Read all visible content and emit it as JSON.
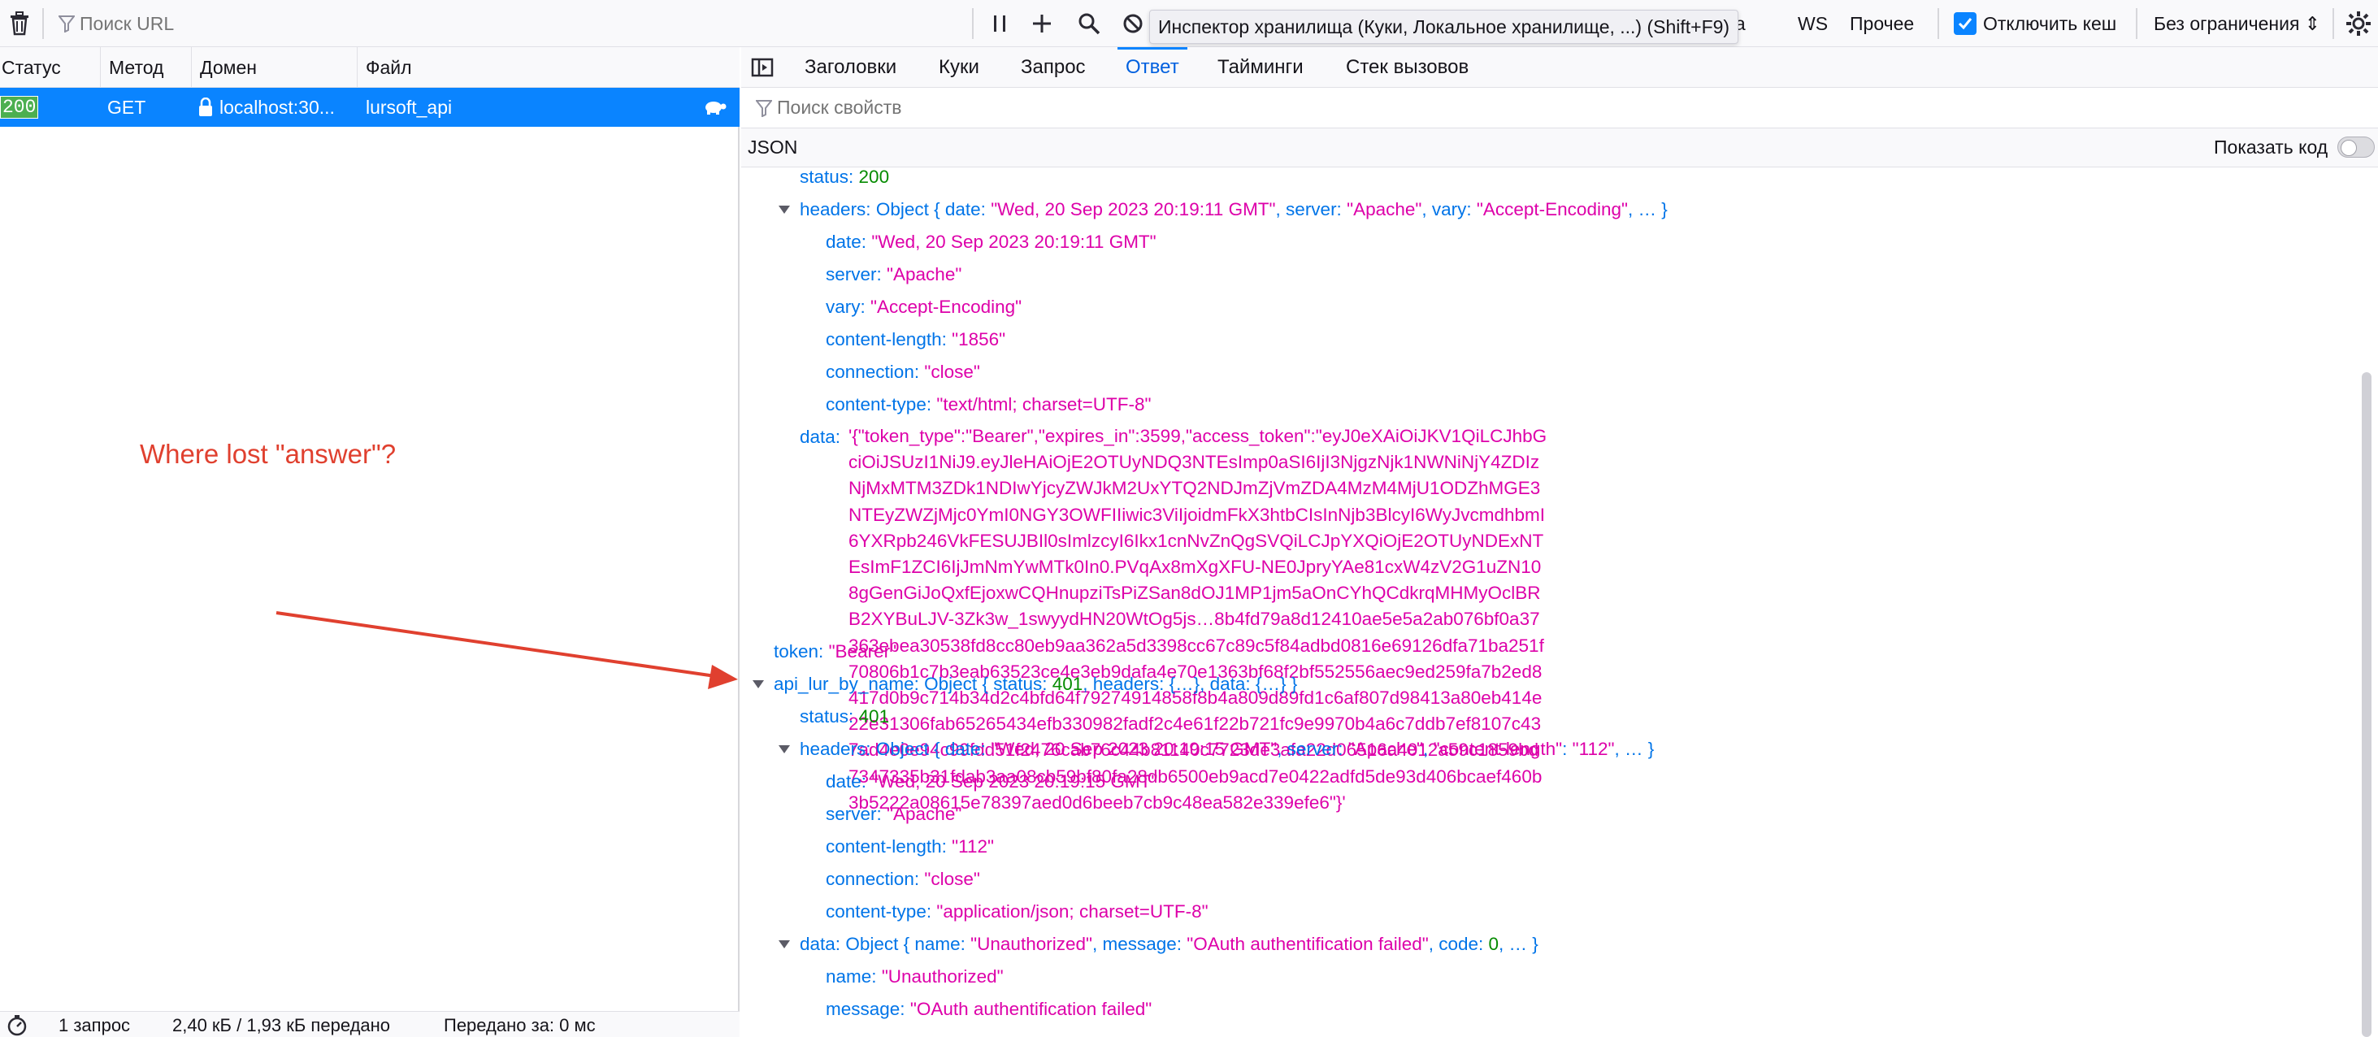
{
  "toolbar": {
    "search_placeholder": "Поиск URL",
    "tooltip": "Инспектор хранилища (Куки, Локальное хранилище, ...) (Shift+F9)",
    "partial_filter": "иа",
    "ws_label": "WS",
    "other_label": "Прочее",
    "disable_cache_label": "Отключить кеш",
    "disable_cache_checked": true,
    "throttle_label": "Без ограничения ⇕"
  },
  "request_list": {
    "columns": [
      "Статус",
      "Метод",
      "Домен",
      "Файл"
    ],
    "row": {
      "status": "200",
      "method": "GET",
      "domain": "localhost:30...",
      "file": "lursoft_api"
    },
    "annotation": "Where lost \"answer\"?"
  },
  "footer": {
    "requests": "1 запрос",
    "transferred": "2,40 кБ / 1,93 кБ передано",
    "time": "Передано за: 0 мс"
  },
  "detail": {
    "tabs": [
      "Заголовки",
      "Куки",
      "Запрос",
      "Ответ",
      "Тайминги",
      "Стек вызовов"
    ],
    "active_tab": "Ответ",
    "filter_placeholder": "Поиск свойств",
    "json_label": "JSON",
    "show_code_label": "Показать код"
  },
  "json": {
    "status_key": "status:",
    "status_val": "200",
    "headers_key": "headers:",
    "headers_summary_obj": "Object",
    "headers_summary_1": "{ date: ",
    "headers_summary_date": "\"Wed, 20 Sep 2023 20:19:11 GMT\"",
    "headers_summary_2": ", server: ",
    "headers_summary_server": "\"Apache\"",
    "headers_summary_3": ", vary: ",
    "headers_summary_vary": "\"Accept-Encoding\"",
    "headers_summary_4": ", … }",
    "h_date_key": "date:",
    "h_date_val": "\"Wed, 20 Sep 2023 20:19:11 GMT\"",
    "h_server_key": "server:",
    "h_server_val": "\"Apache\"",
    "h_vary_key": "vary:",
    "h_vary_val": "\"Accept-Encoding\"",
    "h_cl_key": "content-length:",
    "h_cl_val": "\"1856\"",
    "h_conn_key": "connection:",
    "h_conn_val": "\"close\"",
    "h_ct_key": "content-type:",
    "h_ct_val": "\"text/html; charset=UTF-8\"",
    "data_key": "data:",
    "data_val": "'{\"token_type\":\"Bearer\",\"expires_in\":3599,\"access_token\":\"eyJ0eXAiOiJKV1QiLCJhbGciOiJSUzI1NiJ9.eyJleHAiOjE2OTUyNDQ3NTEsImp0aSI6IjI3NjgzNjk1NWNiNjY4ZDIzNjMxMTM3ZDk1NDIwYjcyZWJkM2UxYTQ2NDJmZjVmZDA4MzM4MjU1ODZhMGE3NTEyZWZjMjc0YmI0NGY3OWFIIiwic3ViIjoidmFkX3htbCIsInNjb3BlcyI6WyJvcmdhbmI6YXRpb246VkFESUJBIl0sImlzcyI6Ikx1cnNvZnQgSVQiLCJpYXQiOjE2OTUyNDExNTEsImF1ZCI6IjJmNmYwMTk0In0.PVqAx8mXgXFU-NE0JpryYAe81cxW4zV2G1uZN108gGenGiJoQxfEjoxwCQHnupziTsPiZSan8dOJ1MP1jm5aOnCYhQCdkrqMHMyOclBRB2XYBuLJV-3Zk3w_1swyydHN20WtOg5js…8b4fd79a8d12410ae5e5a2ab076bf0a37363ebea30538fd8cc80eb9aa362a5d3398cc67c89c5f84adbd0816e69126dfa71ba251f70806b1c7b3eab63523ce4e3eb9dafa4e70e1363bf68f2bf552556aec9ed259fa7b2ed8417d0b9c714b34d2c4bfd64f79274914858f8b4a809d89fd1c6af807d98413a80eb414e22e31306fab65265434efb330982fadf2c4e61f22b721fc9e9970b4a6c7ddb7ef8107c437ad4e0e94c99fdd51f2476cab76c44b81140c7723de3afa22d06516a4012a59c1859bd7347335b31fdab3aa08cb59bf80fa28db6500eb9acd7e0422adfd5de93d406bcaef460b3b5222a08615e78397aed0d6beeb7cb9c48ea582e339efe6\"}'",
    "token_key": "token:",
    "token_val": "\"Bearer\"",
    "api_key": "api_lur_by_name:",
    "api_obj": "Object",
    "api_sum_1": "{ status: ",
    "api_sum_status": "401",
    "api_sum_2": ", headers: {…}, data: {…} }",
    "s2_key": "status:",
    "s2_val": "401",
    "h2_key": "headers:",
    "h2_obj": "Object",
    "h2_sum_1": "{ date: ",
    "h2_sum_date": "\"Wed, 20 Sep 2023 20:19:15 GMT\"",
    "h2_sum_2": ", server: ",
    "h2_sum_server": "\"Apache\"",
    "h2_sum_3": ", ",
    "h2_sum_cl_key": "\"content-length\"",
    "h2_sum_4": ": ",
    "h2_sum_cl": "\"112\"",
    "h2_sum_5": ", … }",
    "h2_date_key": "date:",
    "h2_date_val": "\"Wed, 20 Sep 2023 20:19:15 GMT\"",
    "h2_server_key": "server:",
    "h2_server_val": "\"Apache\"",
    "h2_cl_key": "content-length:",
    "h2_cl_val": "\"112\"",
    "h2_conn_key": "connection:",
    "h2_conn_val": "\"close\"",
    "h2_ct_key": "content-type:",
    "h2_ct_val": "\"application/json; charset=UTF-8\"",
    "d2_key": "data:",
    "d2_obj": "Object",
    "d2_sum_1": "{ name: ",
    "d2_sum_name": "\"Unauthorized\"",
    "d2_sum_2": ", message: ",
    "d2_sum_msg": "\"OAuth authentification failed\"",
    "d2_sum_3": ", code: ",
    "d2_sum_code": "0",
    "d2_sum_4": ", … }",
    "d2_name_key": "name:",
    "d2_name_val": "\"Unauthorized\"",
    "d2_msg_key": "message:",
    "d2_msg_val": "\"OAuth authentification failed\""
  },
  "colors": {
    "accent": "#0a84ff",
    "json_key": "#0074e8",
    "json_string": "#dd00a9",
    "json_number": "#058b00",
    "annotation": "#e0402f"
  }
}
